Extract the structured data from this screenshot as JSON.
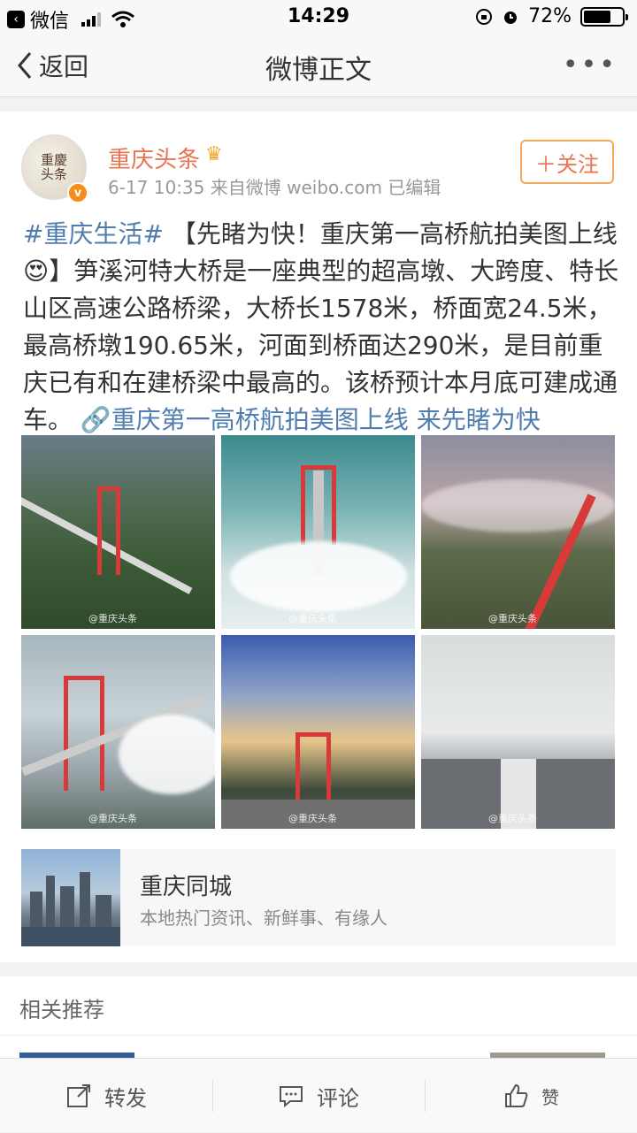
{
  "status_bar": {
    "back_app": "微信",
    "time": "14:29",
    "battery": "72%",
    "battery_level": 0.72
  },
  "nav": {
    "back_label": "返回",
    "title": "微博正文",
    "more": "•••"
  },
  "post": {
    "avatar_text": "重慶\n头条",
    "author": "重庆头条",
    "meta": "6-17 10:35  来自微博 weibo.com  已编辑",
    "follow_label": "＋关注",
    "hashtag": "#重庆生活#",
    "body": " 【先睹为快！重庆第一高桥航拍美图上线😍】笋溪河特大桥是一座典型的超高墩、大跨度、特长山区高速公路桥梁，大桥长1578米，桥面宽24.5米，最高桥墩190.65米，河面到桥面达290米，是目前重庆已有和在建桥梁中最高的。该桥预计本月底可建成通车。",
    "link_text": "重庆第一高桥航拍美图上线 来先睹为快",
    "photo_watermark": "@重庆头条"
  },
  "promo": {
    "title": "重庆同城",
    "description": "本地热门资讯、新鲜事、有缘人"
  },
  "related": {
    "title": "相关推荐"
  },
  "toolbar": {
    "repost": "转发",
    "comment": "评论",
    "like": "赞"
  }
}
